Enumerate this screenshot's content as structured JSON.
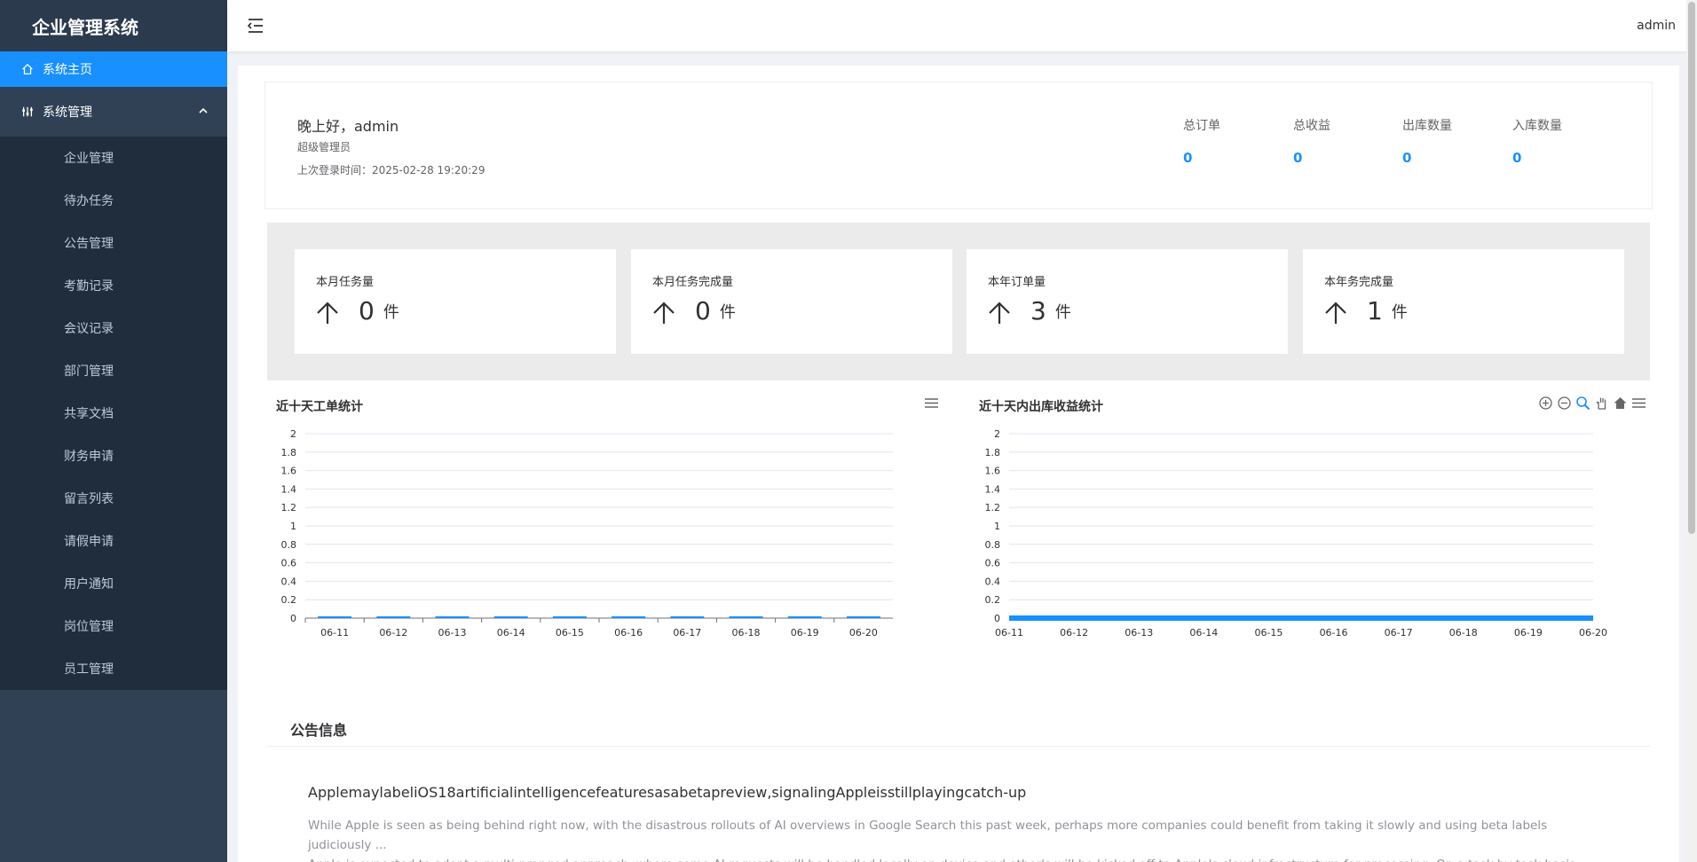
{
  "app": {
    "title": "企业管理系统"
  },
  "sidebar": {
    "home": "系统主页",
    "group": "系统管理",
    "items": [
      "企业管理",
      "待办任务",
      "公告管理",
      "考勤记录",
      "会议记录",
      "部门管理",
      "共享文档",
      "财务申请",
      "留言列表",
      "请假申请",
      "用户通知",
      "岗位管理",
      "员工管理"
    ]
  },
  "topbar": {
    "user": "admin"
  },
  "welcome": {
    "greeting": "晚上好，admin",
    "role": "超级管理员",
    "last_login": "上次登录时间：2025-02-28 19:20:29",
    "stats": [
      {
        "label": "总订单",
        "value": "0"
      },
      {
        "label": "总收益",
        "value": "0"
      },
      {
        "label": "出库数量",
        "value": "0"
      },
      {
        "label": "入库数量",
        "value": "0"
      }
    ]
  },
  "cards": [
    {
      "title": "本月任务量",
      "value": "0",
      "unit": "件"
    },
    {
      "title": "本月任务完成量",
      "value": "0",
      "unit": "件"
    },
    {
      "title": "本年订单量",
      "value": "3",
      "unit": "件"
    },
    {
      "title": "本年务完成量",
      "value": "1",
      "unit": "件"
    }
  ],
  "colors": {
    "primary": "#1890ff",
    "sidebar": "#304156",
    "submenu": "#1f2d3d"
  },
  "chart_data": [
    {
      "type": "bar",
      "title": "近十天工单统计",
      "categories": [
        "06-11",
        "06-12",
        "06-13",
        "06-14",
        "06-15",
        "06-16",
        "06-17",
        "06-18",
        "06-19",
        "06-20"
      ],
      "values": [
        0,
        0,
        0,
        0,
        0,
        0,
        0,
        0,
        0,
        0
      ],
      "yticks": [
        "0",
        "0.2",
        "0.4",
        "0.6",
        "0.8",
        "1",
        "1.2",
        "1.4",
        "1.6",
        "1.8",
        "2"
      ],
      "ylim": [
        0,
        2
      ],
      "grid": true
    },
    {
      "type": "area",
      "title": "近十天内出库收益统计",
      "categories": [
        "06-11",
        "06-12",
        "06-13",
        "06-14",
        "06-15",
        "06-16",
        "06-17",
        "06-18",
        "06-19",
        "06-20"
      ],
      "values": [
        0,
        0,
        0,
        0,
        0,
        0,
        0,
        0,
        0,
        0
      ],
      "yticks": [
        "0",
        "0.2",
        "0.4",
        "0.6",
        "0.8",
        "1",
        "1.2",
        "1.4",
        "1.6",
        "1.8",
        "2"
      ],
      "ylim": [
        0,
        2
      ],
      "grid": true
    }
  ],
  "notice": {
    "title": "公告信息",
    "news_title": "ApplemaylabeliOS18artificialintelligencefeaturesasabetapreview,signalingAppleisstillplayingcatch-up",
    "news_line1": "While Apple is seen as being behind right now, with the disastrous rollouts of AI overviews in Google Search this past week, perhaps more companies could benefit from taking it slowly and using beta labels judiciously ...",
    "news_line2": "Apple is expected to adopt a multi-pronged approach, where some AI requests will be handled locally on device and other's will be kicked off to Apple's cloud infrastructure for processing. On a task by task basis, code"
  }
}
